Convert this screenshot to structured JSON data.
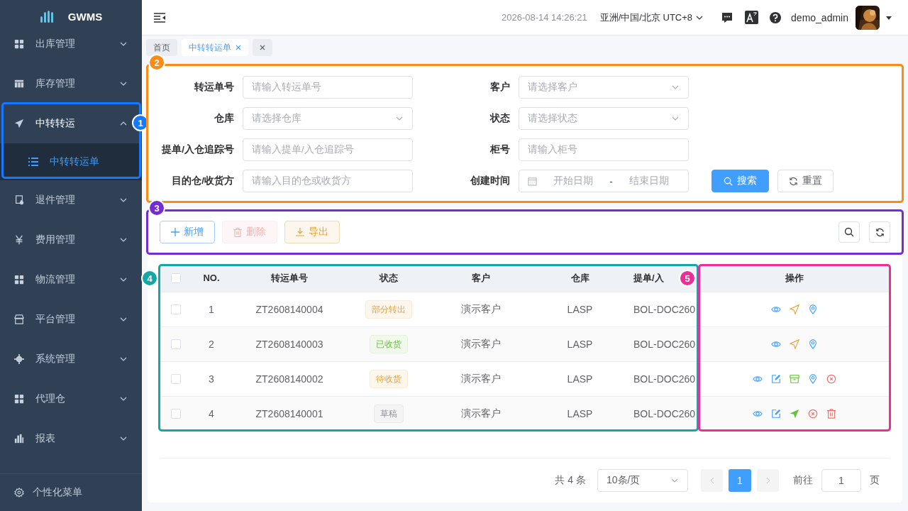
{
  "sidebar": {
    "logo": "GWMS",
    "items": [
      {
        "label": "出库管理",
        "expanded": false
      },
      {
        "label": "库存管理",
        "expanded": false
      },
      {
        "label": "中转转运",
        "expanded": true,
        "children": [
          {
            "label": "中转转运单",
            "selected": true
          }
        ]
      },
      {
        "label": "退件管理",
        "expanded": false
      },
      {
        "label": "费用管理",
        "expanded": false
      },
      {
        "label": "物流管理",
        "expanded": false
      },
      {
        "label": "平台管理",
        "expanded": false
      },
      {
        "label": "系统管理",
        "expanded": false
      },
      {
        "label": "代理仓",
        "expanded": false
      },
      {
        "label": "报表",
        "expanded": false
      }
    ],
    "footer": "个性化菜单"
  },
  "header": {
    "datetime": "2026-08-14 14:26:21",
    "timezone": "亚洲/中国/北京 UTC+8",
    "username": "demo_admin"
  },
  "tabs": [
    {
      "label": "首页",
      "selected": false,
      "closable": false
    },
    {
      "label": "中转转运单",
      "selected": true,
      "closable": true
    },
    {
      "selected": false,
      "closable": true
    }
  ],
  "search_form": {
    "fields": [
      {
        "label": "转运单号",
        "kind": "text",
        "placeholder": "请输入转运单号"
      },
      {
        "label": "客户",
        "kind": "select",
        "placeholder": "请选择客户"
      },
      {
        "label": "仓库",
        "kind": "select",
        "placeholder": "请选择仓库"
      },
      {
        "label": "状态",
        "kind": "select",
        "placeholder": "请选择状态"
      },
      {
        "label": "提单/入仓追踪号",
        "kind": "text",
        "placeholder": "请输入提单/入仓追踪号"
      },
      {
        "label": "柜号",
        "kind": "text",
        "placeholder": "请输入柜号"
      },
      {
        "label": "目的仓/收货方",
        "kind": "text",
        "placeholder": "请输入目的仓或收货方"
      },
      {
        "label": "创建时间",
        "kind": "daterange",
        "start_placeholder": "开始日期",
        "separator": "-",
        "end_placeholder": "结束日期"
      }
    ],
    "buttons": [
      {
        "label": "搜索",
        "kind": "primary"
      },
      {
        "label": "重置",
        "kind": "default"
      }
    ]
  },
  "toolbar": {
    "buttons": [
      {
        "label": "新增",
        "kind": "add",
        "disabled": false
      },
      {
        "label": "删除",
        "kind": "delete",
        "disabled": true
      },
      {
        "label": "导出",
        "kind": "export",
        "disabled": false
      }
    ]
  },
  "table": {
    "columns": [
      "NO.",
      "转运单号",
      "状态",
      "客户",
      "仓库",
      "提单/入",
      "操作"
    ],
    "header_checked": false,
    "rows": [
      {
        "checked": false,
        "no": "1",
        "order": "ZT2608140004",
        "status": {
          "label": "部分转出",
          "kind": "warning"
        },
        "customer": "演示客户",
        "warehouse": "LASP",
        "bol": "BOL-DOC260",
        "actions": [
          {
            "kind": "view"
          },
          {
            "kind": "ship"
          },
          {
            "kind": "locate"
          }
        ]
      },
      {
        "checked": false,
        "no": "2",
        "order": "ZT2608140003",
        "status": {
          "label": "已收货",
          "kind": "success"
        },
        "customer": "演示客户",
        "warehouse": "LASP",
        "bol": "BOL-DOC260",
        "actions": [
          {
            "kind": "view"
          },
          {
            "kind": "ship"
          },
          {
            "kind": "locate"
          }
        ]
      },
      {
        "checked": false,
        "no": "3",
        "order": "ZT2608140002",
        "status": {
          "label": "待收货",
          "kind": "warning"
        },
        "customer": "演示客户",
        "warehouse": "LASP",
        "bol": "BOL-DOC260",
        "actions": [
          {
            "kind": "view"
          },
          {
            "kind": "edit"
          },
          {
            "kind": "archive"
          },
          {
            "kind": "locate"
          },
          {
            "kind": "cancel"
          }
        ]
      },
      {
        "checked": false,
        "no": "4",
        "order": "ZT2608140001",
        "status": {
          "label": "草稿",
          "kind": "info"
        },
        "customer": "演示客户",
        "warehouse": "LASP",
        "bol": "BOL-DOC260",
        "actions": [
          {
            "kind": "view"
          },
          {
            "kind": "edit"
          },
          {
            "kind": "send"
          },
          {
            "kind": "cancel"
          },
          {
            "kind": "delete"
          }
        ]
      }
    ]
  },
  "pagination": {
    "total": "共 4 条",
    "page_size": "10条/页",
    "pages": [
      {
        "label": "1",
        "selected": true
      }
    ],
    "goto_label": "前往",
    "goto_value": "1",
    "goto_suffix": "页"
  },
  "annotations": [
    {
      "label": "1",
      "color": "#1677ff"
    },
    {
      "label": "2",
      "color": "#fa8c16"
    },
    {
      "label": "3",
      "color": "#722ed1"
    },
    {
      "label": "4",
      "color": "#13a8a8"
    },
    {
      "label": "5",
      "color": "#eb2f96"
    }
  ]
}
